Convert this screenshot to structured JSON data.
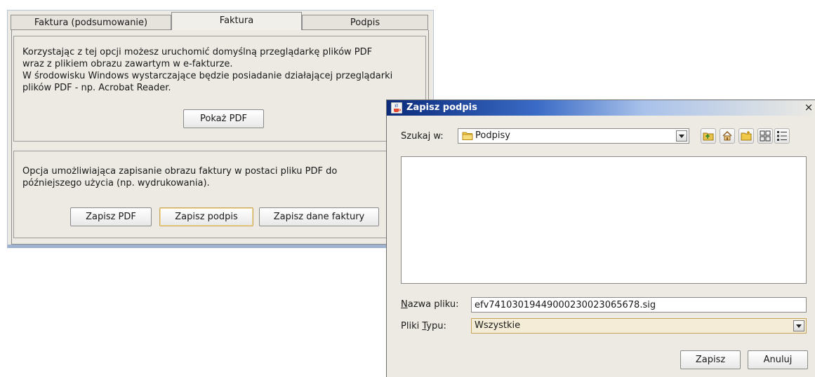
{
  "main": {
    "tabs": [
      {
        "label": "Faktura (podsumowanie)"
      },
      {
        "label": "Faktura"
      },
      {
        "label": "Podpis"
      }
    ],
    "pdf_view": {
      "lines": [
        "Korzystając z tej opcji możesz uruchomić domyślną przeglądarkę plików PDF",
        "wraz z plikiem obrazu zawartym w e-fakturze.",
        "W środowisku Windows wystarczające będzie posiadanie działającej przeglądarki",
        "plików PDF - np. Acrobat Reader."
      ],
      "show_pdf_label": "Pokaż PDF"
    },
    "save_section": {
      "lines": [
        "Opcja umożliwiająca zapisanie obrazu faktury w postaci pliku PDF do",
        "późniejszego użycia (np. wydrukowania)."
      ],
      "save_pdf_label": "Zapisz PDF",
      "save_signature_label": "Zapisz podpis",
      "save_invoice_data_label": "Zapisz dane faktury"
    }
  },
  "dialog": {
    "title": "Zapisz podpis",
    "look_in_label": "Szukaj w:",
    "look_in_value": "Podpisy",
    "file_name_label_first": "N",
    "file_name_label_rest": "azwa pliku:",
    "file_name_value": "efv74103019449000230023065678.sig",
    "file_type_label_first": "Pliki ",
    "file_type_label_underlined": "T",
    "file_type_label_rest": "ypu:",
    "file_type_value": "Wszystkie",
    "save_label": "Zapisz",
    "cancel_label": "Anuluj",
    "close_label": "×"
  },
  "colors": {
    "title_bar_start": "#0b2b7a",
    "title_bar_end": "#a9c2ea",
    "window_bg": "#eceae3",
    "focus_border": "#c9a55a"
  }
}
